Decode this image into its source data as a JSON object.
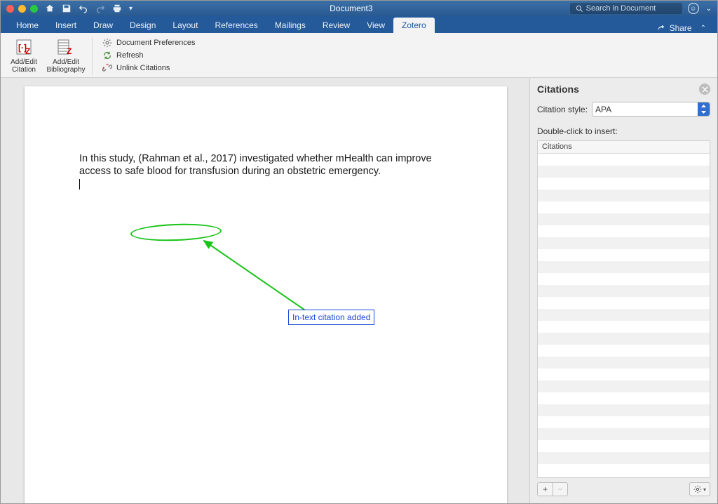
{
  "titlebar": {
    "doc_title": "Document3",
    "search_placeholder": "Search in Document"
  },
  "tabs": {
    "items": [
      "Home",
      "Insert",
      "Draw",
      "Design",
      "Layout",
      "References",
      "Mailings",
      "Review",
      "View",
      "Zotero"
    ],
    "active_index": 9,
    "share_label": "Share"
  },
  "ribbon": {
    "add_edit_citation": "Add/Edit\nCitation",
    "add_edit_bibliography": "Add/Edit\nBibliography",
    "doc_prefs": "Document Preferences",
    "refresh": "Refresh",
    "unlink": "Unlink Citations"
  },
  "document": {
    "text_before": "In this study, ",
    "citation": "(Rahman et al., 2017)",
    "text_after_1": " investigated whether mHealth can improve access to safe blood for transfusion during an obstetric emergency.",
    "annotation_label": "In-text citation added"
  },
  "panel": {
    "title": "Citations",
    "style_label": "Citation style:",
    "style_value": "APA",
    "hint": "Double-click to insert:",
    "list_header": "Citations"
  }
}
